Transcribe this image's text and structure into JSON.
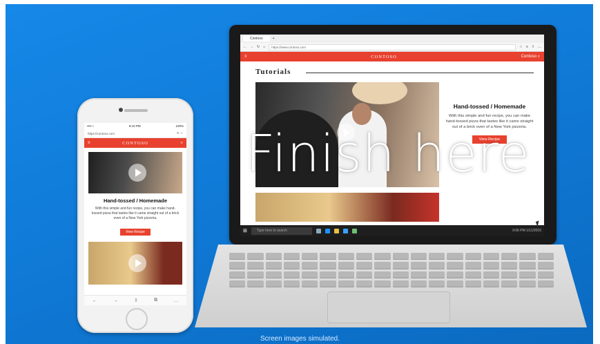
{
  "overlay_text": "Finish here",
  "footer_note": "Screen images simulated.",
  "laptop": {
    "browser": {
      "tab_label": "Contoso",
      "url": "https://www.contoso.com",
      "icons": [
        "back-icon",
        "forward-icon",
        "refresh-icon",
        "home-icon",
        "favorites-icon",
        "hub-icon",
        "share-icon",
        "more-icon"
      ]
    },
    "site": {
      "logo": "CONTOSO",
      "header_right": "Contoso",
      "section_title": "Tutorials",
      "recipe_title": "Hand-tossed / Homemade",
      "recipe_desc": "With this simple and fun recipe, you can make hand-tossed pizza that tastes like it came straight out of a brick oven of a New York pizzeria.",
      "recipe_button": "View Recipe"
    },
    "taskbar": {
      "search_placeholder": "Type here to search",
      "time": "9:06 PM",
      "date": "1/11/2016"
    }
  },
  "phone": {
    "status": {
      "carrier": "•••• ≈",
      "time": "9:10 PM",
      "battery": "100%"
    },
    "url": "https://contoso.com",
    "site": {
      "logo": "CONTOSO",
      "recipe_title": "Hand-tossed / Homemade",
      "recipe_desc": "With this simple and fun recipe, you can make hand-tossed pizza that tastes like it came straight out of a brick oven of a New York pizzeria.",
      "recipe_button": "View Recipe"
    }
  }
}
